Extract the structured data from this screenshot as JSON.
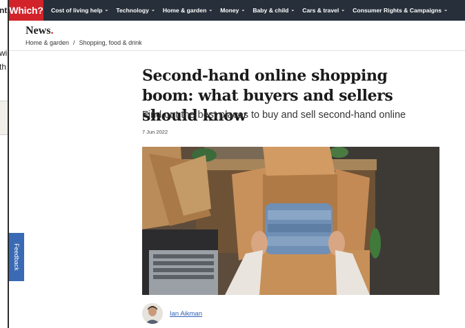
{
  "background_window": {
    "fragment_1": "nt",
    "fragment_2": "wi",
    "fragment_3": "th"
  },
  "nav": {
    "logo": "Which?",
    "items": [
      {
        "label": "Cost of living help"
      },
      {
        "label": "Technology"
      },
      {
        "label": "Home & garden"
      },
      {
        "label": "Money"
      },
      {
        "label": "Baby & child"
      },
      {
        "label": "Cars & travel"
      },
      {
        "label": "Consumer Rights & Campaigns"
      }
    ],
    "chevron_icon": "chevron-down-icon"
  },
  "section": {
    "title": "News",
    "title_dot": "."
  },
  "breadcrumb": {
    "items": [
      {
        "label": "Home & garden"
      },
      {
        "label": "Shopping, food & drink"
      }
    ],
    "separator": "/"
  },
  "article": {
    "headline": "Second-hand online shopping boom: what buyers and sellers should know",
    "standfirst": "Find out the best places to buy and sell second-hand online",
    "date": "7 Jun 2022",
    "author": "Ian Aikman"
  },
  "feedback": {
    "label": "Feedback"
  },
  "colors": {
    "nav_bg": "#27303a",
    "brand_red": "#d2232a",
    "link_blue": "#2f5fb3",
    "feedback_blue": "#3a6ab4"
  }
}
